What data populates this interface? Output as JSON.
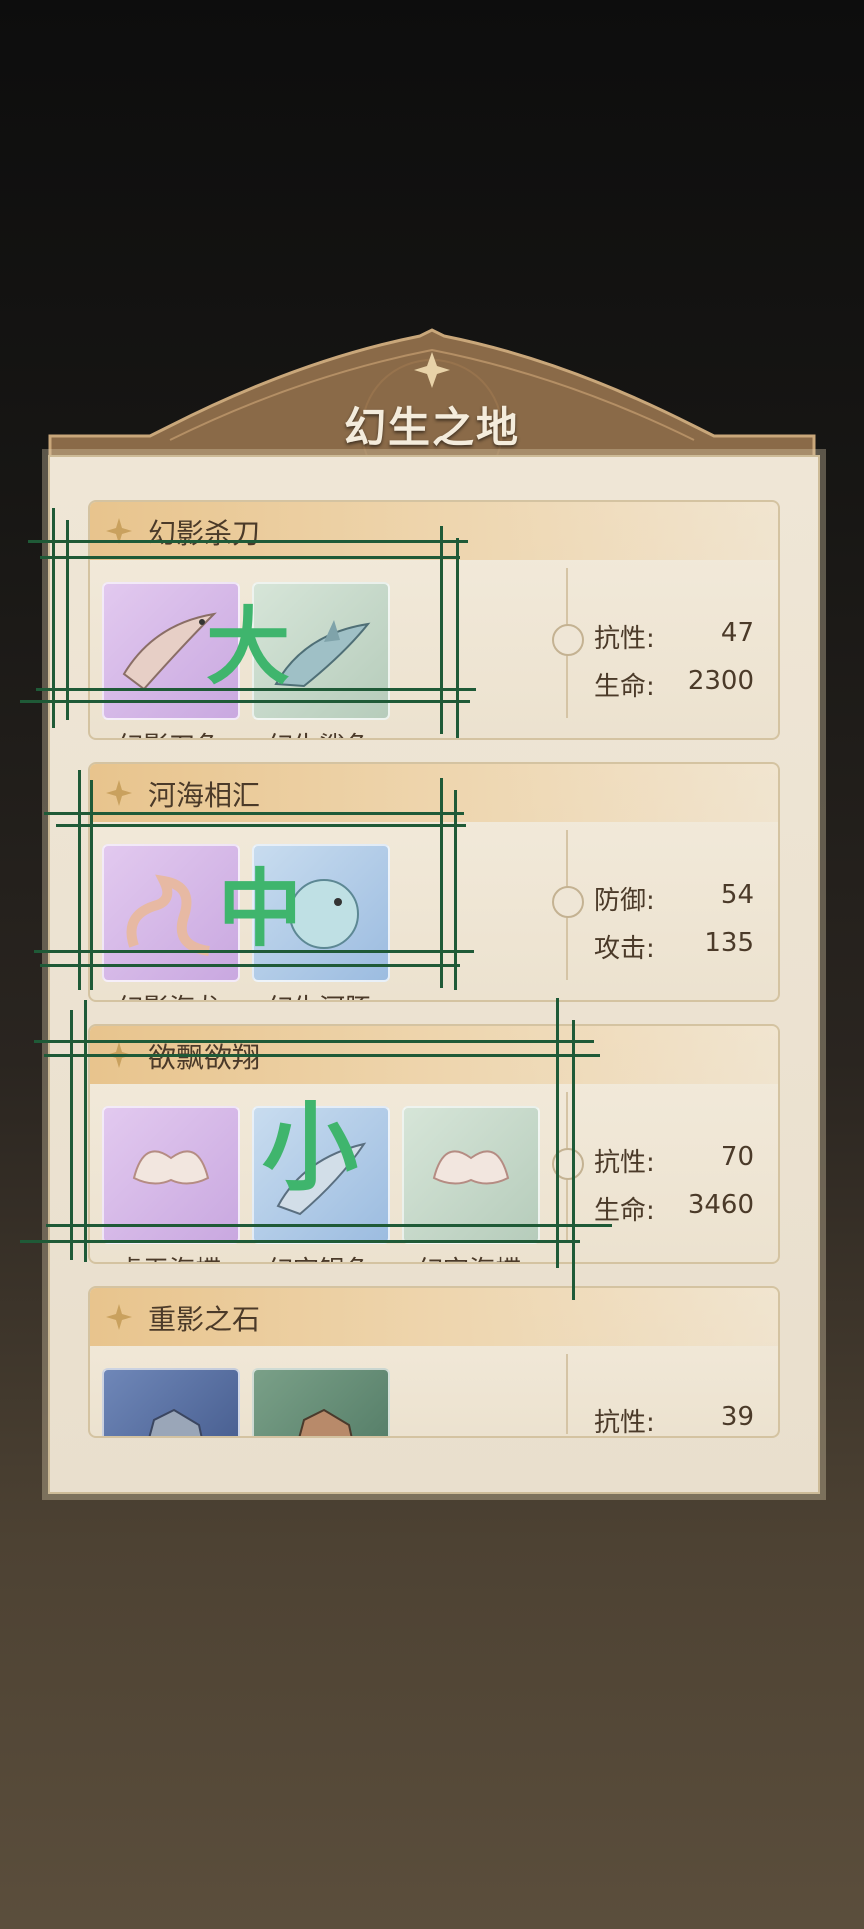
{
  "title": "幻生之地",
  "cards": [
    {
      "title": "幻影杀刀",
      "items": [
        {
          "name": "幻影刀鱼",
          "color": "purple",
          "icon": "sword-fish-icon"
        },
        {
          "name": "幻生鲨鱼",
          "color": "green",
          "icon": "shark-icon"
        }
      ],
      "stats": [
        {
          "label": "抗性:",
          "value": "47"
        },
        {
          "label": "生命:",
          "value": "2300"
        }
      ]
    },
    {
      "title": "河海相汇",
      "items": [
        {
          "name": "幻影海龙",
          "color": "purple",
          "icon": "sea-dragon-icon"
        },
        {
          "name": "幻生河豚",
          "color": "blue",
          "icon": "puffer-fish-icon"
        }
      ],
      "stats": [
        {
          "label": "防御:",
          "value": "54"
        },
        {
          "label": "攻击:",
          "value": "135"
        }
      ]
    },
    {
      "title": "欲飘欲翔",
      "items": [
        {
          "name": "虚无海蝶",
          "color": "purple",
          "icon": "sea-butterfly-icon"
        },
        {
          "name": "幻空银鱼",
          "color": "blue",
          "icon": "silver-fish-icon"
        },
        {
          "name": "幻空海蝶",
          "color": "green",
          "icon": "sea-butterfly-icon"
        }
      ],
      "stats": [
        {
          "label": "抗性:",
          "value": "70"
        },
        {
          "label": "生命:",
          "value": "3460"
        }
      ]
    },
    {
      "title": "重影之石",
      "items": [
        {
          "name": "",
          "color": "dblue",
          "icon": "stone-golem-icon"
        },
        {
          "name": "",
          "color": "dgreen",
          "icon": "stone-golem-icon"
        }
      ],
      "stats": [
        {
          "label": "抗性:",
          "value": "39"
        }
      ]
    }
  ],
  "overlay": {
    "large": "大",
    "medium": "中",
    "small": "小",
    "color": "#3fb56d"
  }
}
